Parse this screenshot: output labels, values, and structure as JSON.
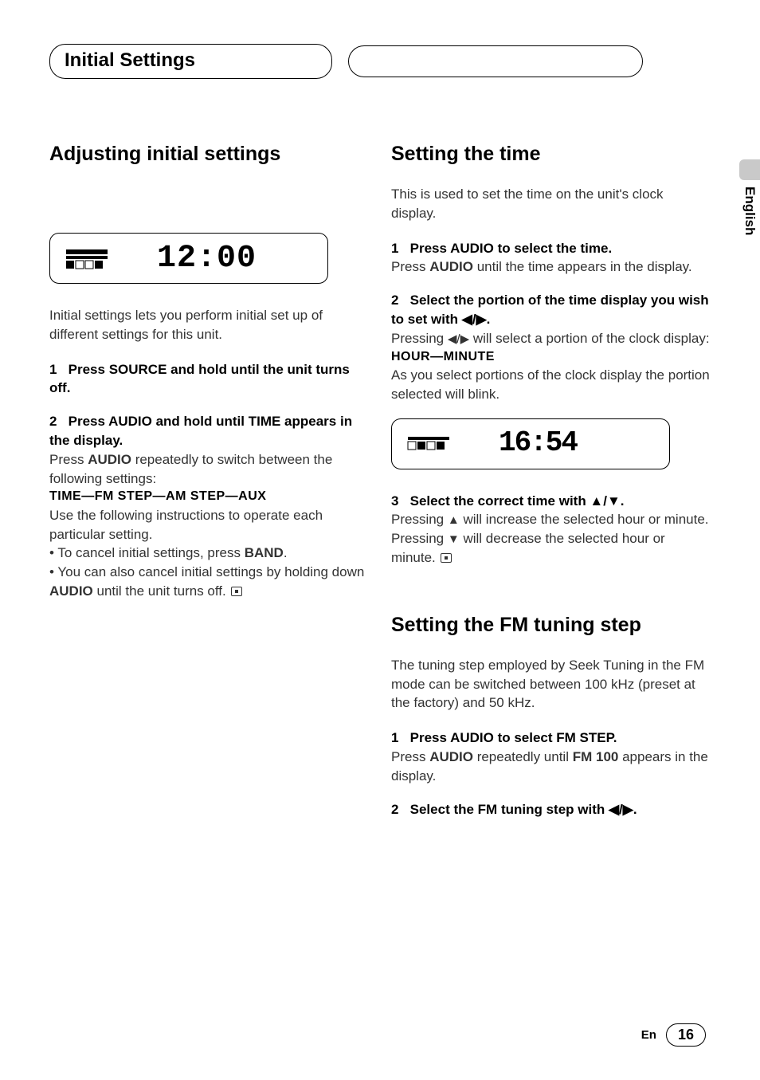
{
  "header": {
    "section_title": "Initial Settings"
  },
  "side": {
    "language": "English"
  },
  "footer": {
    "lang": "En",
    "page": "16"
  },
  "left": {
    "h2": "Adjusting initial settings",
    "lcd1_time": "12:00",
    "intro": "Initial settings lets you perform initial set up of different settings for this unit.",
    "step1": {
      "num": "1",
      "lead_a": "Press ",
      "lead_b": "SOURCE",
      "lead_c": " and hold until the unit turns off."
    },
    "step2": {
      "num": "2",
      "lead_a": "Press ",
      "lead_b": "AUDIO",
      "lead_c": " and hold until ",
      "lead_d": "TIME",
      "lead_e": " appears in the display.",
      "body_a": "Press ",
      "body_b": "AUDIO",
      "body_c": " repeatedly to switch between the following settings:",
      "seq": "TIME—FM STEP—AM STEP—AUX",
      "body2": "Use the following instructions to operate each particular setting.",
      "bullet1_a": "• To cancel initial settings, press ",
      "bullet1_b": "BAND",
      "bullet1_c": ".",
      "bullet2_a": "• You can also cancel initial settings by holding down ",
      "bullet2_b": "AUDIO",
      "bullet2_c": " until the unit turns off."
    }
  },
  "right": {
    "sec1": {
      "h2": "Setting the time",
      "intro": "This is used to set the time on the unit's clock display.",
      "step1": {
        "num": "1",
        "lead_a": "Press ",
        "lead_b": "AUDIO",
        "lead_c": " to select the time.",
        "body_a": "Press ",
        "body_b": "AUDIO",
        "body_c": " until the time appears in the display."
      },
      "step2": {
        "num": "2",
        "lead": "Select the portion of the time display you wish to set with ◀/▶.",
        "body_a": "Pressing ",
        "body_b": "◀/▶",
        "body_c": " will select a portion of the clock display:",
        "seq": "HOUR—MINUTE",
        "body2": "As you select portions of the clock display the portion selected will blink."
      },
      "lcd2_time_line1": "16:54",
      "step3": {
        "num": "3",
        "lead": "Select the correct time with ▲/▼.",
        "body_a": "Pressing ",
        "body_b": "▲",
        "body_c": " will increase the selected hour or minute. Pressing ",
        "body_d": "▼",
        "body_e": " will decrease the selected hour or minute."
      }
    },
    "sec2": {
      "h2": "Setting the FM tuning step",
      "intro": "The tuning step employed by Seek Tuning in the FM mode can be switched between 100 kHz (preset at the factory) and 50 kHz.",
      "step1": {
        "num": "1",
        "lead_a": "Press ",
        "lead_b": "AUDIO",
        "lead_c": " to select ",
        "lead_d": "FM STEP",
        "lead_e": ".",
        "body_a": "Press ",
        "body_b": "AUDIO",
        "body_c": " repeatedly until ",
        "body_d": "FM 100",
        "body_e": " appears in the display."
      },
      "step2": {
        "num": "2",
        "lead": "Select the FM tuning step with ◀/▶."
      }
    }
  }
}
